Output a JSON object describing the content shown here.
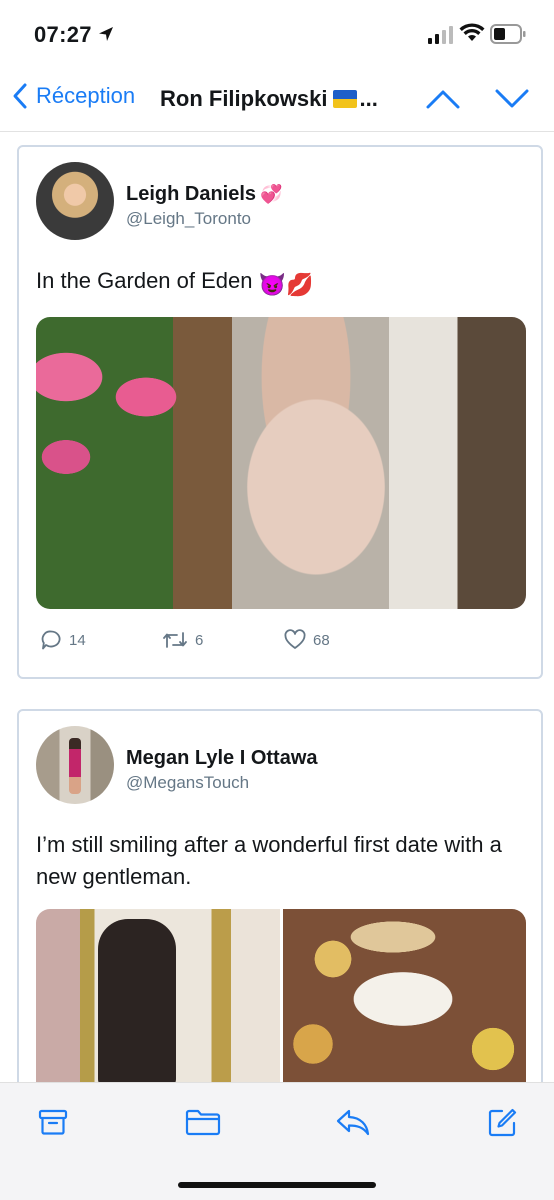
{
  "status": {
    "time": "07:27",
    "icons": [
      "location-arrow-icon",
      "signal-icon",
      "wifi-icon",
      "battery-icon"
    ]
  },
  "nav": {
    "back_label": "Réception",
    "title": "Ron Filipkowski",
    "title_suffix": "...",
    "accent": "#1a7cf5"
  },
  "tweets": [
    {
      "name": "Leigh Daniels",
      "name_emoji": "💞",
      "handle": "@Leigh_Toronto",
      "text": "In the Garden of Eden",
      "text_emojis": "😈💋",
      "replies": "14",
      "retweets": "6",
      "likes": "68"
    },
    {
      "name": "Megan Lyle I Ottawa",
      "handle": "@MegansTouch",
      "text": "I’m still smiling after a wonderful first date with a new gentleman."
    }
  ],
  "toolbar": {
    "icons": [
      "archive-icon",
      "folder-icon",
      "reply-icon",
      "compose-icon"
    ]
  }
}
